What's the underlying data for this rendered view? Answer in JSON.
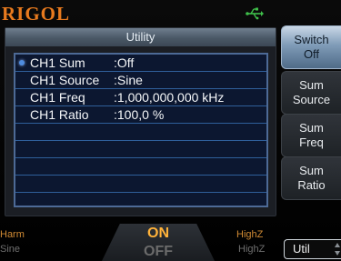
{
  "header": {
    "brand": "RIGOL"
  },
  "panel": {
    "title": "Utility",
    "rows": [
      {
        "label": "CH1 Sum",
        "value": ":Off"
      },
      {
        "label": "CH1 Source",
        "value": ":Sine"
      },
      {
        "label": "CH1 Freq",
        "value": ":1,000,000,000 kHz"
      },
      {
        "label": "CH1 Ratio",
        "value": ":100,0 %"
      }
    ]
  },
  "softkeys": {
    "switch": [
      "Switch",
      "Off"
    ],
    "sum_source": [
      "Sum",
      "Source"
    ],
    "sum_freq": [
      "Sum",
      "Freq"
    ],
    "sum_ratio": [
      "Sum",
      "Ratio"
    ]
  },
  "bottom": {
    "harm_label": "Harm",
    "harm_value": "Sine",
    "on_label": "ON",
    "off_label": "OFF",
    "impedance_label": "HighZ",
    "impedance_value": "HighZ",
    "util_label": "Util"
  },
  "colors": {
    "brand": "#e87a1e",
    "on_accent": "#ffb23a",
    "list_border": "#4d6a96"
  }
}
